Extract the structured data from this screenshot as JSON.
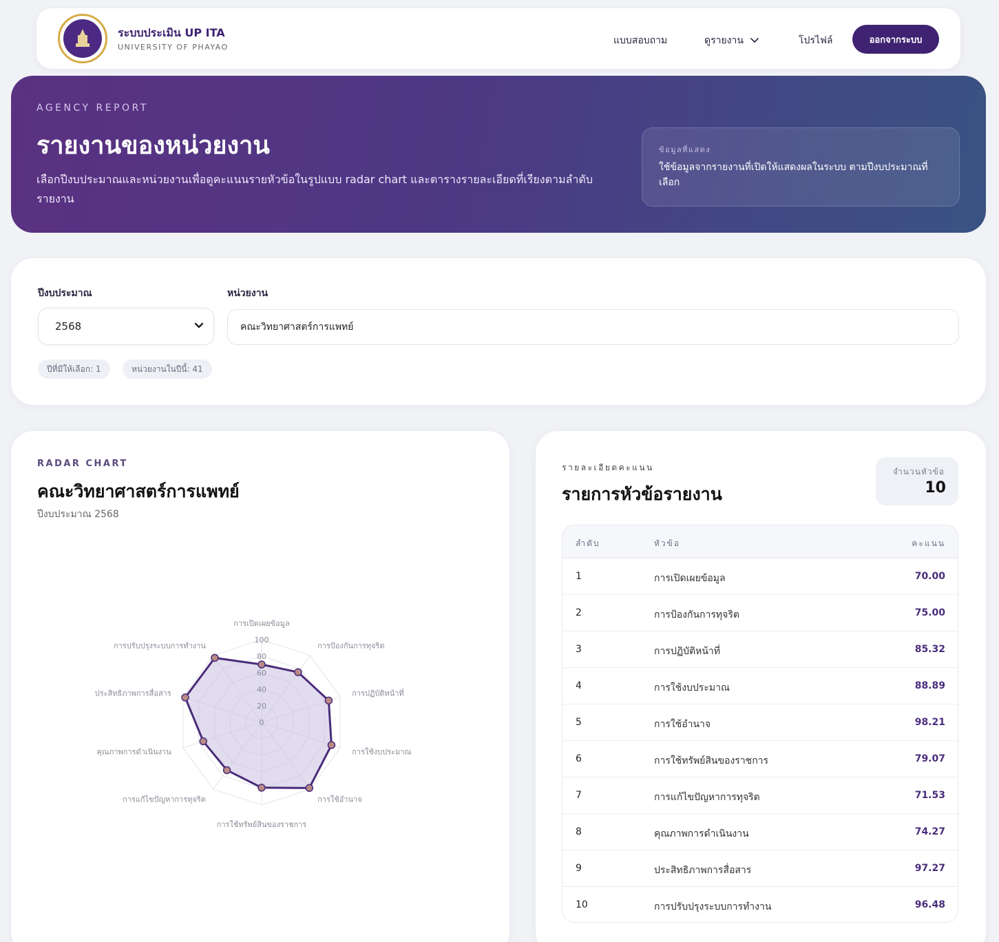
{
  "nav": {
    "brand_title": "ระบบประเมิน UP ITA",
    "brand_subtitle": "UNIVERSITY OF PHAYAO",
    "links": {
      "questionnaire": "แบบสอบถาม",
      "reports": "ดูรายงาน",
      "profile": "โปรไฟล์"
    },
    "logout_label": "ออกจากระบบ"
  },
  "hero": {
    "eyebrow": "AGENCY REPORT",
    "title": "รายงานของหน่วยงาน",
    "description": "เลือกปีงบประมาณและหน่วยงานเพื่อดูคะแนนรายหัวข้อในรูปแบบ radar chart และตารางรายละเอียดที่เรียงตามลำดับรายงาน",
    "info_label": "ข้อมูลที่แสดง",
    "info_text": "ใช้ข้อมูลจากรายงานที่เปิดให้แสดงผลในระบบ ตามปีงบประมาณที่เลือก"
  },
  "filters": {
    "year_label": "ปีงบประมาณ",
    "year_value": "2568",
    "agency_label": "หน่วยงาน",
    "agency_value": "คณะวิทยาศาสตร์การแพทย์",
    "chips": {
      "years_available": "ปีที่มีให้เลือก: 1",
      "agencies_in_year": "หน่วยงานในปีนี้: 41"
    }
  },
  "radar": {
    "eyebrow": "RADAR CHART",
    "title": "คณะวิทยาศาสตร์การแพทย์",
    "subtitle": "ปีงบประมาณ 2568"
  },
  "chart_data": {
    "type": "radar",
    "categories": [
      "การเปิดเผยข้อมูล",
      "การป้องกันการทุจริต",
      "การปฏิบัติหน้าที่",
      "การใช้งบประมาณ",
      "การใช้อำนาจ",
      "การใช้ทรัพย์สินของราชการ",
      "การแก้ไขปัญหาการทุจริต",
      "คุณภาพการดำเนินงาน",
      "ประสิทธิภาพการสื่อสาร",
      "การปรับปรุงระบบการทำงาน"
    ],
    "values": [
      70.0,
      75.0,
      85.32,
      88.89,
      98.21,
      79.07,
      71.53,
      74.27,
      97.27,
      96.48
    ],
    "ticks": [
      "0",
      "20",
      "40",
      "60",
      "80",
      "100"
    ],
    "range": [
      0,
      100
    ],
    "colors": {
      "line": "#4a2c7a",
      "fill": "#c9bfe0",
      "point": "#b98a86"
    }
  },
  "table": {
    "eyebrow": "รายละเอียดคะแนน",
    "title": "รายการหัวข้อรายงาน",
    "count_label": "จำนวนหัวข้อ",
    "count_value": "10",
    "headers": {
      "no": "ลำดับ",
      "topic": "หัวข้อ",
      "score": "คะแนน"
    },
    "rows": [
      {
        "no": "1",
        "topic": "การเปิดเผยข้อมูล",
        "score": "70.00"
      },
      {
        "no": "2",
        "topic": "การป้องกันการทุจริต",
        "score": "75.00"
      },
      {
        "no": "3",
        "topic": "การปฏิบัติหน้าที่",
        "score": "85.32"
      },
      {
        "no": "4",
        "topic": "การใช้งบประมาณ",
        "score": "88.89"
      },
      {
        "no": "5",
        "topic": "การใช้อำนาจ",
        "score": "98.21"
      },
      {
        "no": "6",
        "topic": "การใช้ทรัพย์สินของราชการ",
        "score": "79.07"
      },
      {
        "no": "7",
        "topic": "การแก้ไขปัญหาการทุจริต",
        "score": "71.53"
      },
      {
        "no": "8",
        "topic": "คุณภาพการดำเนินงาน",
        "score": "74.27"
      },
      {
        "no": "9",
        "topic": "ประสิทธิภาพการสื่อสาร",
        "score": "97.27"
      },
      {
        "no": "10",
        "topic": "การปรับปรุงระบบการทำงาน",
        "score": "96.48"
      }
    ]
  }
}
